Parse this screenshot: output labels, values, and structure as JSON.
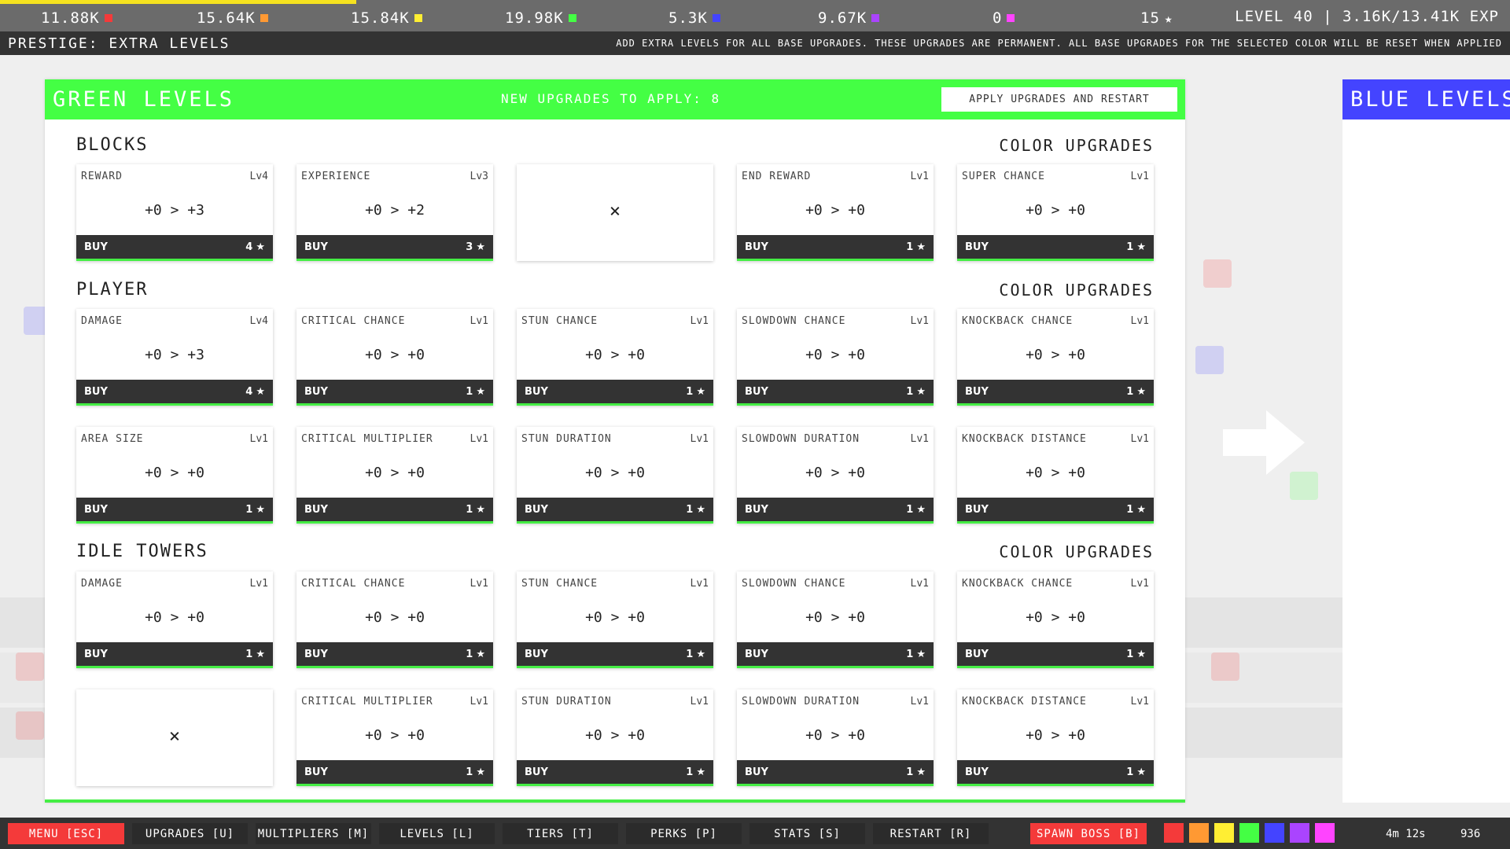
{
  "top": {
    "resources": [
      {
        "value": "11.88K",
        "color": "#f43a3a",
        "icon": "square-icon"
      },
      {
        "value": "15.64K",
        "color": "#ff9933",
        "icon": "square-icon"
      },
      {
        "value": "15.84K",
        "color": "#ffee33",
        "icon": "square-icon"
      },
      {
        "value": "19.98K",
        "color": "#44ff44",
        "icon": "square-icon"
      },
      {
        "value": "5.3K",
        "color": "#4444ff",
        "icon": "square-icon"
      },
      {
        "value": "9.67K",
        "color": "#aa44ff",
        "icon": "square-icon"
      },
      {
        "value": "0",
        "color": "#ff44ff",
        "icon": "square-icon"
      }
    ],
    "stars": "15",
    "level_readout": "LEVEL 40 | 3.16K/13.41K EXP",
    "exp_progress": 0.236
  },
  "info": {
    "title": "PRESTIGE: EXTRA LEVELS",
    "description": "ADD EXTRA LEVELS FOR ALL BASE UPGRADES. THESE UPGRADES ARE PERMANENT. ALL BASE UPGRADES FOR THE SELECTED COLOR WILL BE RESET WHEN APPLIED"
  },
  "panel": {
    "title": "GREEN LEVELS",
    "accent": "#44ff44",
    "pending_label": "NEW UPGRADES TO APPLY: 8",
    "apply_label": "APPLY UPGRADES AND RESTART"
  },
  "sections": [
    {
      "title": "BLOCKS",
      "right": "COLOR UPGRADES"
    },
    {
      "title": "PLAYER",
      "right": "COLOR UPGRADES"
    },
    {
      "title": "IDLE TOWERS",
      "right": "COLOR UPGRADES"
    }
  ],
  "buy_label": "BUY",
  "empty_mark": "×",
  "cards": [
    {
      "name": "REWARD",
      "lvl": "Lv4",
      "val": "+0 > +3",
      "cost": "4"
    },
    {
      "name": "EXPERIENCE",
      "lvl": "Lv3",
      "val": "+0 > +2",
      "cost": "3"
    },
    {
      "empty": true
    },
    {
      "name": "END REWARD",
      "lvl": "Lv1",
      "val": "+0 > +0",
      "cost": "1"
    },
    {
      "name": "SUPER CHANCE",
      "lvl": "Lv1",
      "val": "+0 > +0",
      "cost": "1"
    },
    {
      "name": "DAMAGE",
      "lvl": "Lv4",
      "val": "+0 > +3",
      "cost": "4"
    },
    {
      "name": "CRITICAL CHANCE",
      "lvl": "Lv1",
      "val": "+0 > +0",
      "cost": "1"
    },
    {
      "name": "STUN CHANCE",
      "lvl": "Lv1",
      "val": "+0 > +0",
      "cost": "1"
    },
    {
      "name": "SLOWDOWN CHANCE",
      "lvl": "Lv1",
      "val": "+0 > +0",
      "cost": "1"
    },
    {
      "name": "KNOCKBACK CHANCE",
      "lvl": "Lv1",
      "val": "+0 > +0",
      "cost": "1"
    },
    {
      "name": "AREA SIZE",
      "lvl": "Lv1",
      "val": "+0 > +0",
      "cost": "1"
    },
    {
      "name": "CRITICAL MULTIPLIER",
      "lvl": "Lv1",
      "val": "+0 > +0",
      "cost": "1"
    },
    {
      "name": "STUN DURATION",
      "lvl": "Lv1",
      "val": "+0 > +0",
      "cost": "1"
    },
    {
      "name": "SLOWDOWN DURATION",
      "lvl": "Lv1",
      "val": "+0 > +0",
      "cost": "1"
    },
    {
      "name": "KNOCKBACK DISTANCE",
      "lvl": "Lv1",
      "val": "+0 > +0",
      "cost": "1"
    },
    {
      "name": "DAMAGE",
      "lvl": "Lv1",
      "val": "+0 > +0",
      "cost": "1"
    },
    {
      "name": "CRITICAL CHANCE",
      "lvl": "Lv1",
      "val": "+0 > +0",
      "cost": "1"
    },
    {
      "name": "STUN CHANCE",
      "lvl": "Lv1",
      "val": "+0 > +0",
      "cost": "1"
    },
    {
      "name": "SLOWDOWN CHANCE",
      "lvl": "Lv1",
      "val": "+0 > +0",
      "cost": "1"
    },
    {
      "name": "KNOCKBACK CHANCE",
      "lvl": "Lv1",
      "val": "+0 > +0",
      "cost": "1"
    },
    {
      "empty": true
    },
    {
      "name": "CRITICAL MULTIPLIER",
      "lvl": "Lv1",
      "val": "+0 > +0",
      "cost": "1"
    },
    {
      "name": "STUN DURATION",
      "lvl": "Lv1",
      "val": "+0 > +0",
      "cost": "1"
    },
    {
      "name": "SLOWDOWN DURATION",
      "lvl": "Lv1",
      "val": "+0 > +0",
      "cost": "1"
    },
    {
      "name": "KNOCKBACK DISTANCE",
      "lvl": "Lv1",
      "val": "+0 > +0",
      "cost": "1"
    }
  ],
  "side_panel": {
    "title": "BLUE LEVELS",
    "accent": "#4444ff"
  },
  "nav": {
    "menu": "MENU [ESC]",
    "upgrades": "UPGRADES [U]",
    "multipliers": "MULTIPLIERS [M]",
    "levels": "LEVELS [L]",
    "tiers": "TIERS [T]",
    "perks": "PERKS [P]",
    "stats": "STATS [S]",
    "restart": "RESTART [R]",
    "spawn_boss": "SPAWN BOSS [B]",
    "color_chips": [
      "#f43a3a",
      "#ff9933",
      "#ffee33",
      "#44ff44",
      "#4444ff",
      "#aa44ff",
      "#ff44ff"
    ],
    "timer": "4m 12s",
    "fps": "936"
  }
}
